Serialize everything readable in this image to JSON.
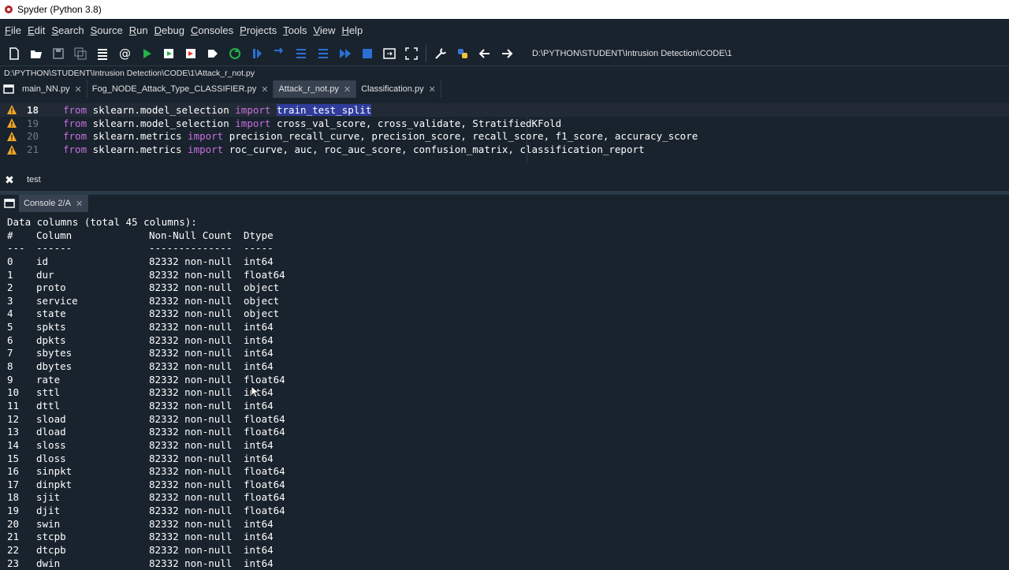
{
  "window": {
    "title": "Spyder (Python 3.8)"
  },
  "menu": [
    "File",
    "Edit",
    "Search",
    "Source",
    "Run",
    "Debug",
    "Consoles",
    "Projects",
    "Tools",
    "View",
    "Help"
  ],
  "toolbar": {
    "working_dir": "D:\\PYTHON\\STUDENT\\Intrusion Detection\\CODE\\1",
    "icons": [
      "new-file-icon",
      "open-file-icon",
      "save-icon",
      "save-all-icon",
      "outline-icon",
      "at-icon",
      "run-icon",
      "run-cell-icon",
      "run-cell-advance-icon",
      "run-selection-icon",
      "rerun-icon",
      "debug-icon",
      "step-icon",
      "step-into-icon",
      "step-return-icon",
      "continue-icon",
      "stop-icon",
      "maximize-pane-icon",
      "fullscreen-icon",
      "preferences-icon",
      "python-path-icon",
      "back-icon",
      "forward-icon"
    ]
  },
  "editor": {
    "file_path": "D:\\PYTHON\\STUDENT\\Intrusion Detection\\CODE\\1\\Attack_r_not.py",
    "tabs": [
      {
        "label": "main_NN.py",
        "active": false
      },
      {
        "label": "Fog_NODE_Attack_Type_CLASSIFIER.py",
        "active": false
      },
      {
        "label": "Attack_r_not.py",
        "active": true
      },
      {
        "label": "Classification.py",
        "active": false
      }
    ],
    "lines": [
      {
        "num": "18",
        "kw1": "from",
        "mod": " sklearn.model_selection ",
        "kw2": "import",
        "rest": " ",
        "sel": "train_test_split",
        "tail": ""
      },
      {
        "num": "19",
        "kw1": "from",
        "mod": " sklearn.model_selection ",
        "kw2": "import",
        "rest": " cross_val_score, cross_validate, StratifiedKFold",
        "sel": "",
        "tail": ""
      },
      {
        "num": "20",
        "kw1": "from",
        "mod": " sklearn.metrics ",
        "kw2": "import",
        "rest": " precision_recall_curve, precision_score, recall_score, f1_score, accuracy_score",
        "sel": "",
        "tail": ""
      },
      {
        "num": "21",
        "kw1": "from",
        "mod": " sklearn.metrics ",
        "kw2": "import",
        "rest": " roc_curve, auc, roc_auc_score, confusion_matrix, classification_report",
        "sel": "",
        "tail": ""
      }
    ]
  },
  "find": {
    "text": "test"
  },
  "console": {
    "tab_label": "Console 2/A",
    "header_line": "Data columns (total 45 columns):",
    "headers": [
      "#",
      "Column",
      "Non-Null Count",
      "Dtype"
    ],
    "dashes": [
      "---",
      "------",
      "--------------",
      "-----"
    ],
    "rows": [
      [
        "0",
        "id",
        "82332 non-null",
        "int64"
      ],
      [
        "1",
        "dur",
        "82332 non-null",
        "float64"
      ],
      [
        "2",
        "proto",
        "82332 non-null",
        "object"
      ],
      [
        "3",
        "service",
        "82332 non-null",
        "object"
      ],
      [
        "4",
        "state",
        "82332 non-null",
        "object"
      ],
      [
        "5",
        "spkts",
        "82332 non-null",
        "int64"
      ],
      [
        "6",
        "dpkts",
        "82332 non-null",
        "int64"
      ],
      [
        "7",
        "sbytes",
        "82332 non-null",
        "int64"
      ],
      [
        "8",
        "dbytes",
        "82332 non-null",
        "int64"
      ],
      [
        "9",
        "rate",
        "82332 non-null",
        "float64"
      ],
      [
        "10",
        "sttl",
        "82332 non-null",
        "int64"
      ],
      [
        "11",
        "dttl",
        "82332 non-null",
        "int64"
      ],
      [
        "12",
        "sload",
        "82332 non-null",
        "float64"
      ],
      [
        "13",
        "dload",
        "82332 non-null",
        "float64"
      ],
      [
        "14",
        "sloss",
        "82332 non-null",
        "int64"
      ],
      [
        "15",
        "dloss",
        "82332 non-null",
        "int64"
      ],
      [
        "16",
        "sinpkt",
        "82332 non-null",
        "float64"
      ],
      [
        "17",
        "dinpkt",
        "82332 non-null",
        "float64"
      ],
      [
        "18",
        "sjit",
        "82332 non-null",
        "float64"
      ],
      [
        "19",
        "djit",
        "82332 non-null",
        "float64"
      ],
      [
        "20",
        "swin",
        "82332 non-null",
        "int64"
      ],
      [
        "21",
        "stcpb",
        "82332 non-null",
        "int64"
      ],
      [
        "22",
        "dtcpb",
        "82332 non-null",
        "int64"
      ],
      [
        "23",
        "dwin",
        "82332 non-null",
        "int64"
      ]
    ]
  }
}
